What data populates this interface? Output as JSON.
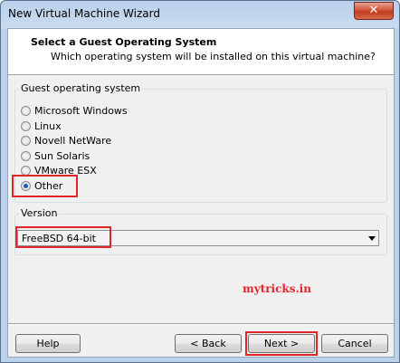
{
  "window": {
    "title": "New Virtual Machine Wizard",
    "close_glyph": "✕"
  },
  "header": {
    "title": "Select a Guest Operating System",
    "subtitle": "Which operating system will be installed on this virtual machine?"
  },
  "guest_os": {
    "group_label": "Guest operating system",
    "options": [
      {
        "label": "Microsoft Windows",
        "checked": false
      },
      {
        "label": "Linux",
        "checked": false
      },
      {
        "label": "Novell NetWare",
        "checked": false
      },
      {
        "label": "Sun Solaris",
        "checked": false
      },
      {
        "label": "VMware ESX",
        "checked": false
      },
      {
        "label": "Other",
        "checked": true
      }
    ]
  },
  "version": {
    "group_label": "Version",
    "selected": "FreeBSD 64-bit"
  },
  "watermark": "mytricks.in",
  "buttons": {
    "help": "Help",
    "back": "< Back",
    "next": "Next >",
    "cancel": "Cancel"
  },
  "colors": {
    "highlight": "#e0262a",
    "radio_selected": "#1f5fb8"
  }
}
